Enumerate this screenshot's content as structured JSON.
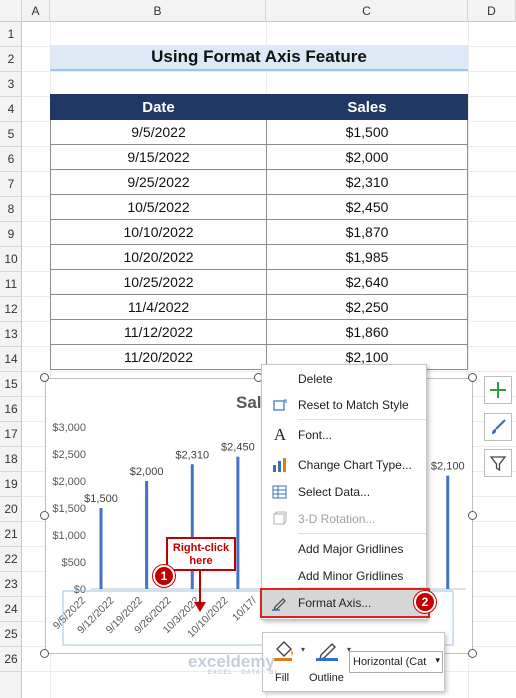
{
  "columns": [
    "A",
    "B",
    "C",
    "D"
  ],
  "rows": [
    "1",
    "2",
    "3",
    "4",
    "5",
    "6",
    "7",
    "8",
    "9",
    "10",
    "11",
    "12",
    "13",
    "14",
    "15",
    "16",
    "17",
    "18",
    "19",
    "20",
    "21",
    "22",
    "23",
    "24",
    "25",
    "26"
  ],
  "title": "Using Format Axis Feature",
  "table": {
    "headers": [
      "Date",
      "Sales"
    ],
    "rows": [
      [
        "9/5/2022",
        "$1,500"
      ],
      [
        "9/15/2022",
        "$2,000"
      ],
      [
        "9/25/2022",
        "$2,310"
      ],
      [
        "10/5/2022",
        "$2,450"
      ],
      [
        "10/10/2022",
        "$1,870"
      ],
      [
        "10/20/2022",
        "$1,985"
      ],
      [
        "10/25/2022",
        "$2,640"
      ],
      [
        "11/4/2022",
        "$2,250"
      ],
      [
        "11/12/2022",
        "$1,860"
      ],
      [
        "11/20/2022",
        "$2,100"
      ]
    ]
  },
  "chart_data": {
    "type": "bar",
    "title": "Sal",
    "yticks": [
      "$3,000",
      "$2,500",
      "$2,000",
      "$1,500",
      "$1,000",
      "$500",
      "$0"
    ],
    "ylim": [
      0,
      3000
    ],
    "xticks": [
      "9/5/2022",
      "9/12/2022",
      "9/19/2022",
      "9/26/2022",
      "10/3/2022",
      "10/10/2022",
      "10/17/",
      "11/7/",
      "11/14/"
    ],
    "x": [
      "2022-09-05",
      "2022-09-15",
      "2022-09-25",
      "2022-10-05",
      "2022-11-20"
    ],
    "values": [
      1500,
      2000,
      2310,
      2450,
      2100
    ],
    "data_labels": [
      "$1,500",
      "$2,000",
      "$2,310",
      "$2,450",
      "$2,100"
    ],
    "bar_color": "#4472c4"
  },
  "context_menu": {
    "items": [
      {
        "label": "Delete",
        "icon": "none",
        "disabled": false
      },
      {
        "label": "Reset to Match Style",
        "icon": "reset-style-icon",
        "disabled": false
      },
      {
        "label": "Font...",
        "icon": "font-icon",
        "disabled": false
      },
      {
        "label": "Change Chart Type...",
        "icon": "chart-type-icon",
        "disabled": false
      },
      {
        "label": "Select Data...",
        "icon": "select-data-icon",
        "disabled": false
      },
      {
        "label": "3-D Rotation...",
        "icon": "3d-rotation-icon",
        "disabled": true
      },
      {
        "label": "Add Major Gridlines",
        "icon": "none",
        "disabled": false
      },
      {
        "label": "Add Minor Gridlines",
        "icon": "none",
        "disabled": false
      },
      {
        "label": "Format Axis...",
        "icon": "format-axis-icon",
        "disabled": false,
        "highlighted": true
      }
    ]
  },
  "mini_toolbar": {
    "fill_label": "Fill",
    "outline_label": "Outline",
    "dropdown_value": "Horizontal (Cat"
  },
  "annotations": {
    "callout_text": "Right-click here",
    "step1": "1",
    "step2": "2"
  },
  "watermark": {
    "brand": "exceldemy",
    "tagline": "EXCEL · DATA · BI"
  }
}
